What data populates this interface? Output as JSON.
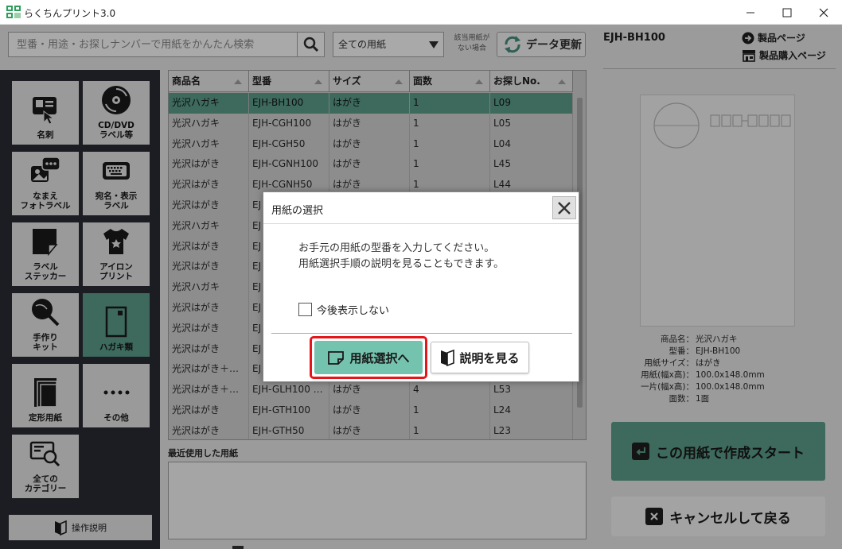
{
  "window": {
    "title": "らくちんプリント3.0",
    "minimize": "—",
    "maximize": "☐",
    "close": "✕"
  },
  "search": {
    "placeholder": "型番・用途・お探しナンバーで用紙をかんたん検索",
    "filter_selected": "全ての用紙",
    "no_paper_note": "該当用紙が\nない場合",
    "update_label": "データ更新"
  },
  "sidebar": {
    "categories": [
      {
        "label": "名刺",
        "icon": "business-card-icon"
      },
      {
        "label": "CD/DVD\nラベル等",
        "icon": "disc-icon"
      },
      {
        "label": "なまえ\nフォトラベル",
        "icon": "photo-label-icon"
      },
      {
        "label": "宛名・表示\nラベル",
        "icon": "address-label-icon"
      },
      {
        "label": "ラベル\nステッカー",
        "icon": "sticker-icon"
      },
      {
        "label": "アイロン\nプリント",
        "icon": "tshirt-icon"
      },
      {
        "label": "手作り\nキット",
        "icon": "fan-icon"
      },
      {
        "label": "ハガキ類",
        "icon": "postcard-icon"
      },
      {
        "label": "定形用紙",
        "icon": "paper-stack-icon"
      },
      {
        "label": "その他",
        "icon": "dots-icon"
      },
      {
        "label": "全ての\nカテゴリー",
        "icon": "search-card-icon"
      }
    ],
    "help_label": "操作説明"
  },
  "table": {
    "headers": [
      "商品名",
      "型番",
      "サイズ",
      "面数",
      "お探しNo."
    ],
    "rows": [
      [
        "光沢ハガキ",
        "EJH-BH100",
        "はがき",
        "1",
        "L09"
      ],
      [
        "光沢ハガキ",
        "EJH-CGH100",
        "はがき",
        "1",
        "L05"
      ],
      [
        "光沢ハガキ",
        "EJH-CGH50",
        "はがき",
        "1",
        "L04"
      ],
      [
        "光沢はがき",
        "EJH-CGNH100",
        "はがき",
        "1",
        "L45"
      ],
      [
        "光沢はがき",
        "EJH-CGNH50",
        "はがき",
        "1",
        "L44"
      ],
      [
        "光沢はがき",
        "EJ",
        "",
        "",
        ""
      ],
      [
        "光沢ハガキ",
        "EJ",
        "",
        "",
        ""
      ],
      [
        "光沢はがき",
        "EJ",
        "",
        "",
        ""
      ],
      [
        "光沢はがき",
        "EJ",
        "",
        "",
        ""
      ],
      [
        "光沢ハガキ",
        "EJ",
        "",
        "",
        ""
      ],
      [
        "光沢はがき",
        "EJ",
        "",
        "",
        ""
      ],
      [
        "光沢はがき",
        "EJ",
        "",
        "",
        ""
      ],
      [
        "光沢はがき",
        "EJ",
        "",
        "",
        ""
      ],
      [
        "光沢はがき＋…",
        "EJ",
        "",
        "",
        ""
      ],
      [
        "光沢はがき＋…",
        "EJH-GLH100 …",
        "はがき",
        "4",
        "L53"
      ],
      [
        "光沢はがき",
        "EJH-GTH100",
        "はがき",
        "1",
        "L24"
      ],
      [
        "光沢はがき",
        "EJH-GTH50",
        "はがき",
        "1",
        "L23"
      ]
    ]
  },
  "recent": {
    "title": "最近使用した用紙"
  },
  "detail": {
    "model": "EJH-BH100",
    "product_page": "製品ページ",
    "purchase_page": "製品購入ページ",
    "specs": [
      {
        "k": "商品名：",
        "v": "光沢ハガキ"
      },
      {
        "k": "型番：",
        "v": "EJH-BH100"
      },
      {
        "k": "用紙サイズ：",
        "v": "はがき"
      },
      {
        "k": "用紙(幅x高)：",
        "v": "100.0x148.0mm"
      },
      {
        "k": "一片(幅x高)：",
        "v": "100.0x148.0mm"
      },
      {
        "k": "面数：",
        "v": "1面"
      }
    ],
    "start_label": "この用紙で作成スタート",
    "cancel_label": "キャンセルして戻る"
  },
  "modal": {
    "title": "用紙の選択",
    "message_line1": "お手元の用紙の型番を入力してください。",
    "message_line2": "用紙選択手順の説明を見ることもできます。",
    "checkbox_label": "今後表示しない",
    "select_button": "用紙選択へ",
    "guide_button": "説明を見る"
  },
  "colors": {
    "accent": "#74c3ae",
    "selected_row": "#3d6a5d",
    "highlight": "#e4161a",
    "sidebar_bg": "#1c1d22"
  }
}
